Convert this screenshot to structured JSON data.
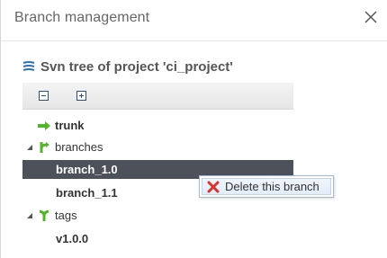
{
  "dialog": {
    "title": "Branch management"
  },
  "panel": {
    "title": "Svn tree of project 'ci_project'"
  },
  "tree": {
    "trunk": "trunk",
    "branches": "branches",
    "branch_1": "branch_1.0",
    "branch_2": "branch_1.1",
    "tags": "tags",
    "tag_1": "v1.0.0"
  },
  "context_menu": {
    "delete_label": "Delete this branch"
  },
  "colors": {
    "selected_row": "#4d525a",
    "arrow_green": "#53b42a",
    "menu_border": "#a5b7d6",
    "delete_red": "#d9322b"
  }
}
